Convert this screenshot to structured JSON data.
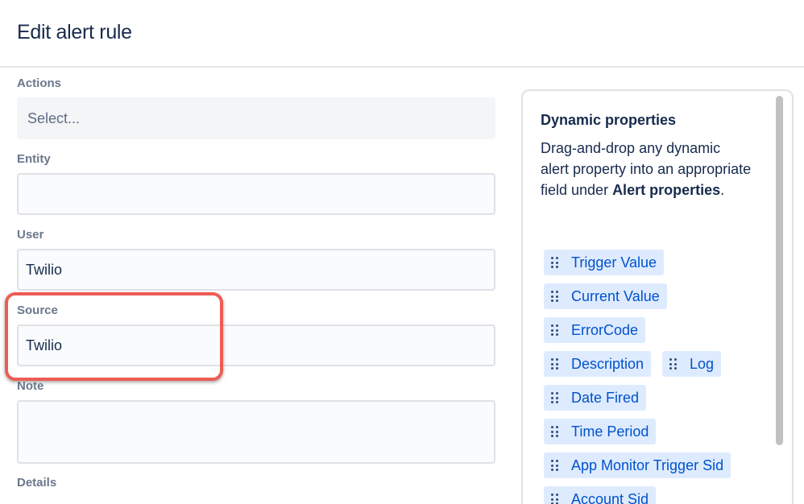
{
  "page": {
    "title": "Edit alert rule"
  },
  "form": {
    "actions": {
      "label": "Actions",
      "placeholder": "Select..."
    },
    "entity": {
      "label": "Entity",
      "value": ""
    },
    "user": {
      "label": "User",
      "value": "Twilio"
    },
    "source": {
      "label": "Source",
      "value": "Twilio"
    },
    "note": {
      "label": "Note",
      "value": ""
    },
    "details": {
      "label": "Details"
    }
  },
  "dynamic_panel": {
    "title": "Dynamic properties",
    "desc_part1": "Drag-and-drop any dynamic alert property into an appropriate field under ",
    "desc_bold": "Alert properties",
    "desc_part2": ".",
    "chips": [
      "Trigger Value",
      "Current Value",
      "ErrorCode",
      "Description",
      "Log",
      "Date Fired",
      "Time Period",
      "App Monitor Trigger Sid",
      "Account Sid"
    ]
  },
  "colors": {
    "highlight": "#ec5d54",
    "chip_bg": "#deebff",
    "chip_text": "#0052cc"
  }
}
